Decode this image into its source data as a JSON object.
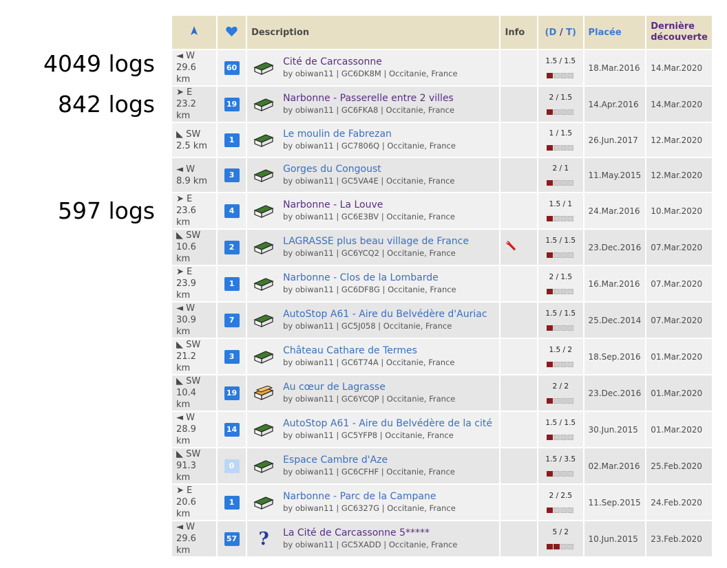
{
  "annotations": [
    "4049 logs",
    "842 logs",
    "597 logs"
  ],
  "header": {
    "direction_icon": "north-arrow-icon",
    "favorites_icon": "heart-icon",
    "description": "Description",
    "info": "Info",
    "dt_open": "(",
    "dt_d": "D",
    "dt_sep": " / ",
    "dt_t": "T",
    "dt_close": ")",
    "placed": "Placée",
    "last_found": "Dernière découverte"
  },
  "colors": {
    "header_bg": "#e8e0c5",
    "link_blue": "#3b6fbf",
    "link_visited": "#5a2d82",
    "fav_badge": "#2a7bde",
    "difficulty_fill": "#8a1c1c"
  },
  "rows": [
    {
      "dir": "◄ W",
      "dist": "29.6 km",
      "fav": "60",
      "name": "Cité de Carcassonne",
      "meta": "by obiwan11 | GC6DK8M | Occitanie, France",
      "dt": "1.5 / 1.5",
      "d": 1.5,
      "placed": "18.Mar.2016",
      "last": "14.Mar.2020",
      "icon": "traditional-cache-icon",
      "visited": true,
      "info": ""
    },
    {
      "dir": "➤ E",
      "dist": "23.2 km",
      "fav": "19",
      "name": "Narbonne - Passerelle entre 2 villes",
      "meta": "by obiwan11 | GC6FKA8 | Occitanie, France",
      "dt": "2 / 1.5",
      "d": 2,
      "placed": "14.Apr.2016",
      "last": "14.Mar.2020",
      "icon": "traditional-cache-icon",
      "visited": true,
      "info": ""
    },
    {
      "dir": "◣ SW",
      "dist": "2.5 km",
      "fav": "1",
      "name": "Le moulin de Fabrezan",
      "meta": "by obiwan11 | GC7806Q | Occitanie, France",
      "dt": "1 / 1.5",
      "d": 1,
      "placed": "26.Jun.2017",
      "last": "12.Mar.2020",
      "icon": "traditional-cache-icon",
      "visited": false,
      "info": ""
    },
    {
      "dir": "◄ W",
      "dist": "8.9 km",
      "fav": "3",
      "name": "Gorges du Congoust",
      "meta": "by obiwan11 | GC5VA4E | Occitanie, France",
      "dt": "2 / 1",
      "d": 2,
      "placed": "11.May.2015",
      "last": "12.Mar.2020",
      "icon": "traditional-cache-icon",
      "visited": false,
      "info": ""
    },
    {
      "dir": "➤ E",
      "dist": "23.6 km",
      "fav": "4",
      "name": "Narbonne - La Louve",
      "meta": "by obiwan11 | GC6E3BV | Occitanie, France",
      "dt": "1.5 / 1",
      "d": 1.5,
      "placed": "24.Mar.2016",
      "last": "10.Mar.2020",
      "icon": "traditional-cache-icon",
      "visited": true,
      "info": ""
    },
    {
      "dir": "◣ SW",
      "dist": "10.6 km",
      "fav": "2",
      "name": "LAGRASSE plus beau village de France",
      "meta": "by obiwan11 | GC6YCQ2 | Occitanie, France",
      "dt": "1.5 / 1.5",
      "d": 1.5,
      "placed": "23.Dec.2016",
      "last": "07.Mar.2020",
      "icon": "traditional-cache-icon",
      "visited": false,
      "info": "wrench-icon"
    },
    {
      "dir": "➤ E",
      "dist": "23.9 km",
      "fav": "1",
      "name": "Narbonne - Clos de la Lombarde",
      "meta": "by obiwan11 | GC6DF8G | Occitanie, France",
      "dt": "2 / 1.5",
      "d": 2,
      "placed": "16.Mar.2016",
      "last": "07.Mar.2020",
      "icon": "traditional-cache-icon",
      "visited": false,
      "info": ""
    },
    {
      "dir": "◄ W",
      "dist": "30.9 km",
      "fav": "7",
      "name": "AutoStop A61 - Aire du Belvédère d'Auriac",
      "meta": "by obiwan11 | GC5J058 | Occitanie, France",
      "dt": "1.5 / 1.5",
      "d": 1.5,
      "placed": "25.Dec.2014",
      "last": "07.Mar.2020",
      "icon": "traditional-cache-icon",
      "visited": false,
      "info": ""
    },
    {
      "dir": "◣ SW",
      "dist": "21.2 km",
      "fav": "3",
      "name": "Château Cathare de Termes",
      "meta": "by obiwan11 | GC6T74A | Occitanie, France",
      "dt": "1.5 / 2",
      "d": 1.5,
      "placed": "18.Sep.2016",
      "last": "01.Mar.2020",
      "icon": "traditional-cache-icon",
      "visited": false,
      "info": ""
    },
    {
      "dir": "◣ SW",
      "dist": "10.4 km",
      "fav": "19",
      "name": "Au cœur de Lagrasse",
      "meta": "by obiwan11 | GC6YCQP | Occitanie, France",
      "dt": "2 / 2",
      "d": 2,
      "placed": "23.Dec.2016",
      "last": "01.Mar.2020",
      "icon": "multi-cache-icon",
      "visited": false,
      "info": ""
    },
    {
      "dir": "◄ W",
      "dist": "28.9 km",
      "fav": "14",
      "name": "AutoStop A61 - Aire du Belvédère de la cité",
      "meta": "by obiwan11 | GC5YFP8 | Occitanie, France",
      "dt": "1.5 / 1.5",
      "d": 1.5,
      "placed": "30.Jun.2015",
      "last": "01.Mar.2020",
      "icon": "traditional-cache-icon",
      "visited": false,
      "info": ""
    },
    {
      "dir": "◣ SW",
      "dist": "91.3 km",
      "fav": "0",
      "name": "Espace Cambre d'Aze",
      "meta": "by obiwan11 | GC6CFHF | Occitanie, France",
      "dt": "1.5 / 3.5",
      "d": 1.5,
      "placed": "02.Mar.2016",
      "last": "25.Feb.2020",
      "icon": "traditional-cache-icon",
      "visited": false,
      "info": ""
    },
    {
      "dir": "➤ E",
      "dist": "20.6 km",
      "fav": "1",
      "name": "Narbonne - Parc de la Campane",
      "meta": "by obiwan11 | GC6327G | Occitanie, France",
      "dt": "2 / 2.5",
      "d": 2,
      "placed": "11.Sep.2015",
      "last": "24.Feb.2020",
      "icon": "traditional-cache-icon",
      "visited": false,
      "info": ""
    },
    {
      "dir": "◄ W",
      "dist": "29.6 km",
      "fav": "57",
      "name": "La Cité de Carcassonne 5*****",
      "meta": "by obiwan11 | GC5XADD | Occitanie, France",
      "dt": "5 / 2",
      "d": 5,
      "placed": "10.Jun.2015",
      "last": "23.Feb.2020",
      "icon": "mystery-cache-icon",
      "visited": true,
      "info": ""
    }
  ]
}
